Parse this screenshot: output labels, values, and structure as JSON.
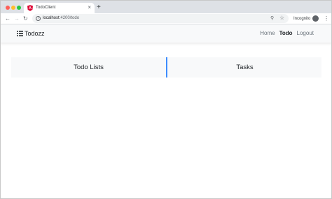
{
  "browser": {
    "tab": {
      "title": "TodoClient",
      "favicon": "angular-icon",
      "close": "×"
    },
    "new_tab": "+",
    "nav": {
      "back": "←",
      "forward": "→",
      "reload": "↻"
    },
    "address": {
      "host": "localhost",
      "path": ":4200/todo"
    },
    "incognito_label": "Incognito",
    "menu": "⋮",
    "zoom": "⚲",
    "star": "☆",
    "info": "i"
  },
  "navbar": {
    "brand": "Todozz",
    "links": [
      {
        "label": "Home",
        "active": false
      },
      {
        "label": "Todo",
        "active": true
      },
      {
        "label": "Logout",
        "active": false
      }
    ]
  },
  "main": {
    "left_title": "Todo Lists",
    "right_title": "Tasks"
  },
  "colors": {
    "accent": "#0d6efd",
    "navbar_bg": "#f8f9fa",
    "chrome_bg": "#dee1e6"
  }
}
